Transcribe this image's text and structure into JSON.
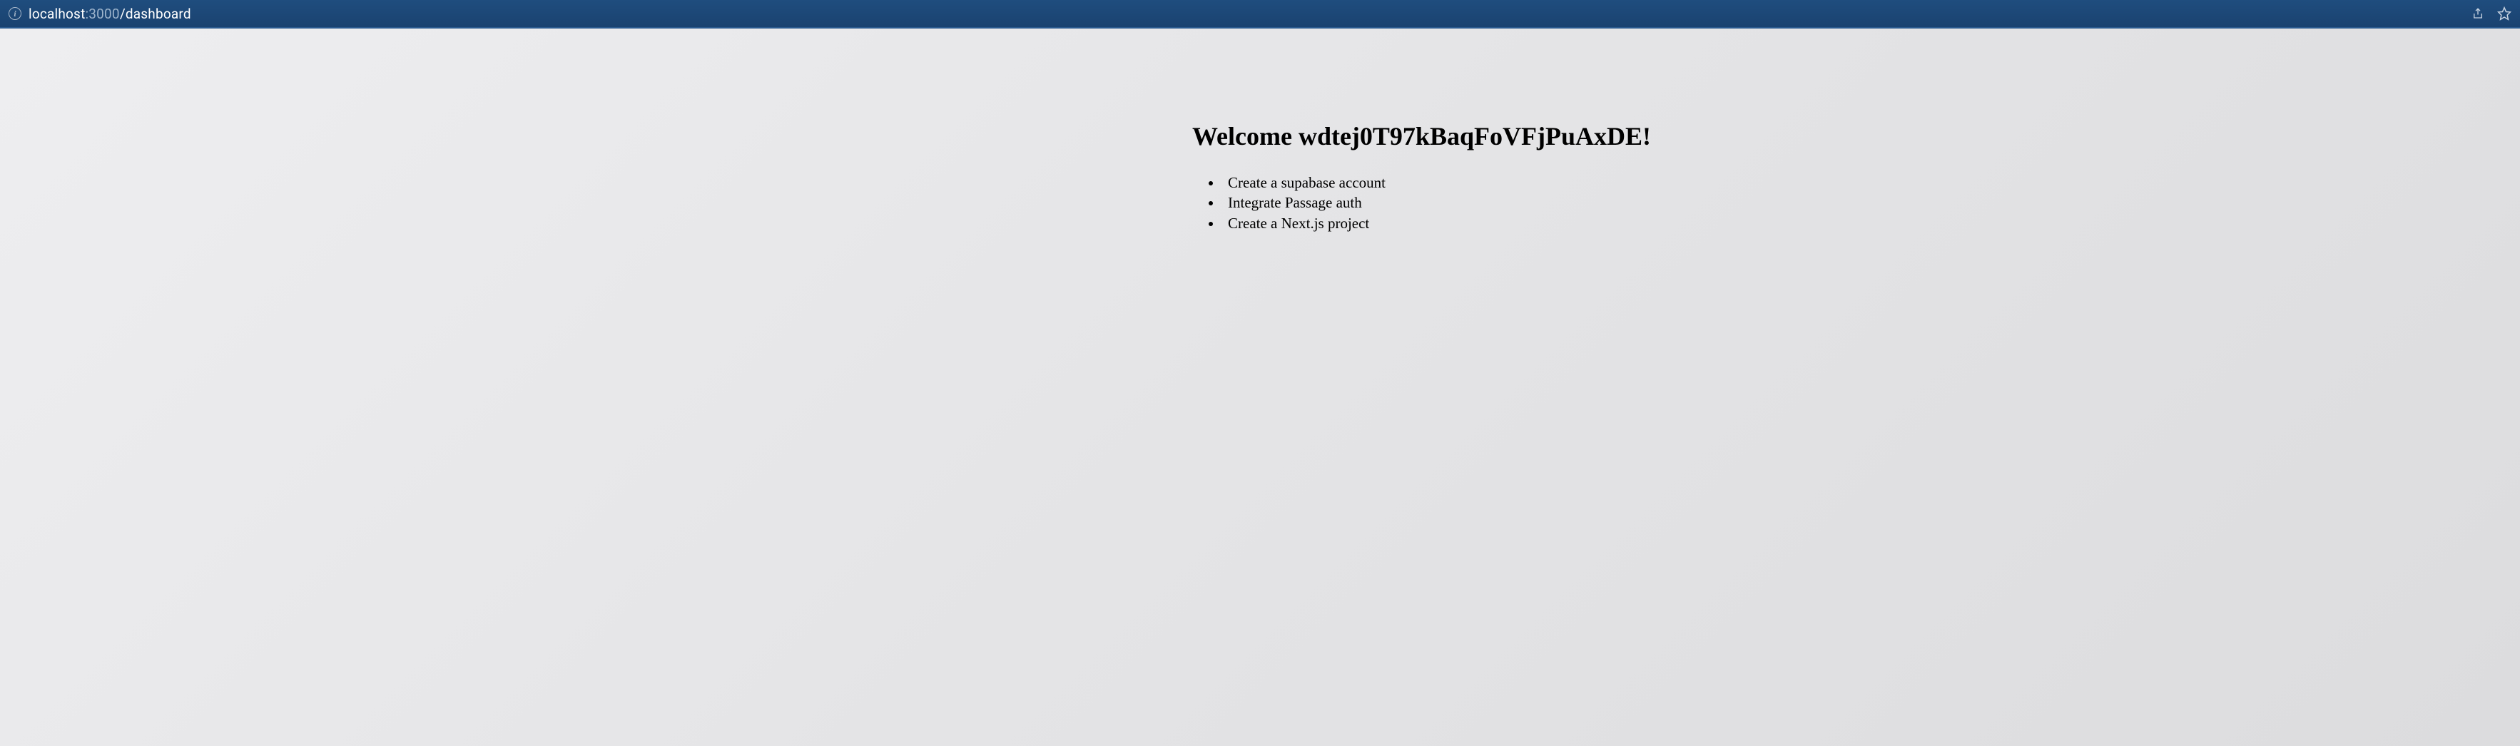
{
  "browser": {
    "url_host": "localhost",
    "url_port": ":3000",
    "url_path": "/dashboard"
  },
  "page": {
    "welcome_heading": "Welcome wdtej0T97kBaqFoVFjPuAxDE!",
    "todos": [
      "Create a supabase account",
      "Integrate Passage auth",
      "Create a Next.js project"
    ]
  }
}
